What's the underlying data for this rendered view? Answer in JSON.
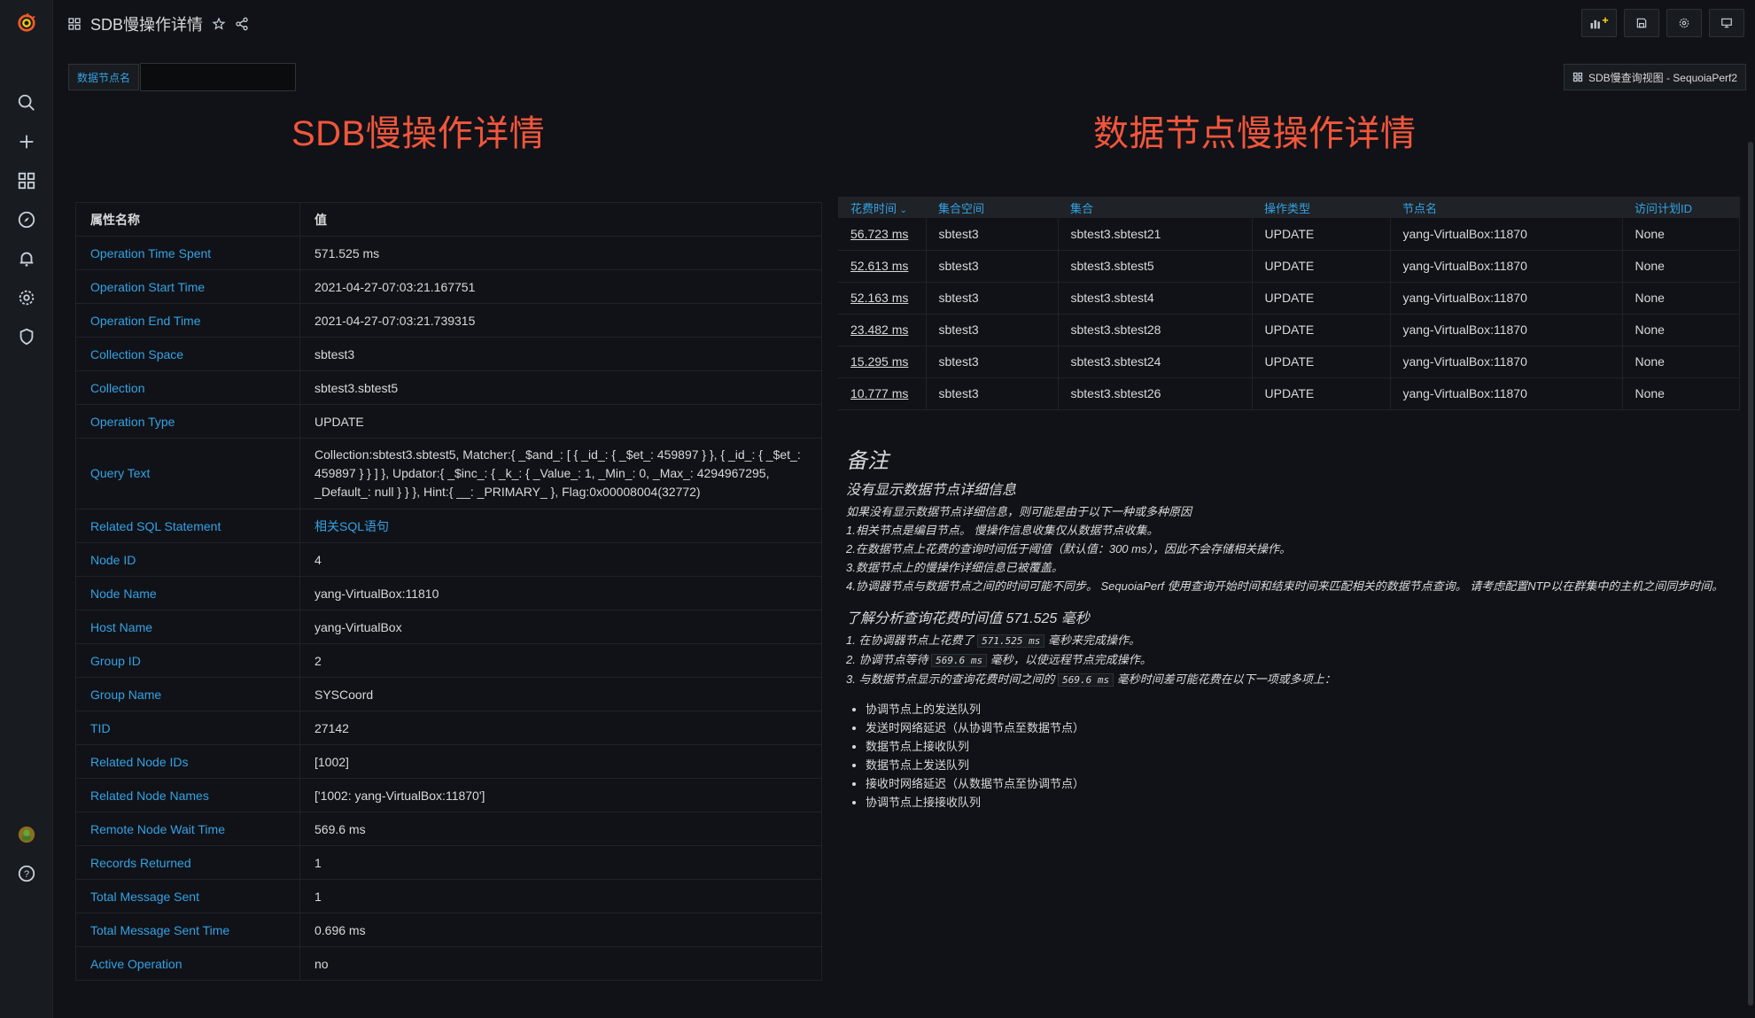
{
  "header": {
    "title": "SDB慢操作详情"
  },
  "variables": {
    "label": "数据节点名",
    "value": ""
  },
  "links": {
    "dashboard_link": "SDB慢查询视图 - SequoiaPerf2"
  },
  "left_panel": {
    "title": "SDB慢操作详情",
    "col_name": "属性名称",
    "col_value": "值",
    "rows": [
      {
        "k": "Operation Time Spent",
        "v": "571.525 ms"
      },
      {
        "k": "Operation Start Time",
        "v": "2021-04-27-07:03:21.167751"
      },
      {
        "k": "Operation End Time",
        "v": "2021-04-27-07:03:21.739315"
      },
      {
        "k": "Collection Space",
        "v": "sbtest3"
      },
      {
        "k": "Collection",
        "v": "sbtest3.sbtest5"
      },
      {
        "k": "Operation Type",
        "v": "UPDATE"
      },
      {
        "k": "Query Text",
        "v": "Collection:sbtest3.sbtest5, Matcher:{ _$and_: [ { _id_: { _$et_: 459897 } }, { _id_: { _$et_: 459897 } } ] }, Updator:{ _$inc_: { _k_: { _Value_: 1, _Min_: 0, _Max_: 4294967295, _Default_: null } } }, Hint:{ __: _PRIMARY_ }, Flag:0x00008004(32772)"
      },
      {
        "k": "Related SQL Statement",
        "v": "相关SQL语句"
      },
      {
        "k": "Node ID",
        "v": "4"
      },
      {
        "k": "Node Name",
        "v": "yang-VirtualBox:11810"
      },
      {
        "k": "Host Name",
        "v": "yang-VirtualBox"
      },
      {
        "k": "Group ID",
        "v": "2"
      },
      {
        "k": "Group Name",
        "v": "SYSCoord"
      },
      {
        "k": "TID",
        "v": "27142"
      },
      {
        "k": "Related Node IDs",
        "v": "[1002]"
      },
      {
        "k": "Related Node Names",
        "v": "['1002: yang-VirtualBox:11870']"
      },
      {
        "k": "Remote Node Wait Time",
        "v": "569.6 ms"
      },
      {
        "k": "Records Returned",
        "v": "1"
      },
      {
        "k": "Total Message Sent",
        "v": "1"
      },
      {
        "k": "Total Message Sent Time",
        "v": "0.696 ms"
      },
      {
        "k": "Active Operation",
        "v": "no"
      }
    ]
  },
  "right_panel": {
    "title": "数据节点慢操作详情",
    "columns": [
      "花费时间",
      "集合空间",
      "集合",
      "操作类型",
      "节点名",
      "访问计划ID"
    ],
    "rows": [
      [
        "56.723 ms",
        "sbtest3",
        "sbtest3.sbtest21",
        "UPDATE",
        "yang-VirtualBox:11870",
        "None"
      ],
      [
        "52.613 ms",
        "sbtest3",
        "sbtest3.sbtest5",
        "UPDATE",
        "yang-VirtualBox:11870",
        "None"
      ],
      [
        "52.163 ms",
        "sbtest3",
        "sbtest3.sbtest4",
        "UPDATE",
        "yang-VirtualBox:11870",
        "None"
      ],
      [
        "23.482 ms",
        "sbtest3",
        "sbtest3.sbtest28",
        "UPDATE",
        "yang-VirtualBox:11870",
        "None"
      ],
      [
        "15.295 ms",
        "sbtest3",
        "sbtest3.sbtest24",
        "UPDATE",
        "yang-VirtualBox:11870",
        "None"
      ],
      [
        "10.777 ms",
        "sbtest3",
        "sbtest3.sbtest26",
        "UPDATE",
        "yang-VirtualBox:11870",
        "None"
      ]
    ]
  },
  "notes": {
    "heading": "备注",
    "subheading": "没有显示数据节点详细信息",
    "intro": "如果没有显示数据节点详细信息，则可能是由于以下一种或多种原因",
    "reasons": [
      "1.相关节点是编目节点。 慢操作信息收集仅从数据节点收集。",
      "2.在数据节点上花费的查询时间低于阈值（默认值：300 ms），因此不会存储相关操作。",
      "3.数据节点上的慢操作详细信息已被覆盖。",
      "4.协调器节点与数据节点之间的时间可能不同步。 SequoiaPerf 使用查询开始时间和结束时间来匹配相关的数据节点查询。 请考虑配置NTP以在群集中的主机之间同步时间。"
    ],
    "analysis_heading": "了解分析查询花费时间值 571.525 毫秒",
    "analysis": [
      {
        "pre": "1. 在协调器节点上花费了",
        "code": "571.525 ms",
        "post": "毫秒来完成操作。"
      },
      {
        "pre": "2. 协调节点等待",
        "code": "569.6 ms",
        "post": "毫秒，以使远程节点完成操作。"
      },
      {
        "pre": "3. 与数据节点显示的查询花费时间之间的",
        "code": "569.6 ms",
        "post": "毫秒时间差可能花费在以下一项或多项上："
      }
    ],
    "bullets": [
      "协调节点上的发送队列",
      "发送时网络延迟（从协调节点至数据节点）",
      "数据节点上接收队列",
      "数据节点上发送队列",
      "接收时网络延迟（从数据节点至协调节点）",
      "协调节点上接接收队列"
    ]
  },
  "colors": {
    "accent_blue": "#33a2e5",
    "title_red": "#f2563c",
    "background": "#111217"
  }
}
